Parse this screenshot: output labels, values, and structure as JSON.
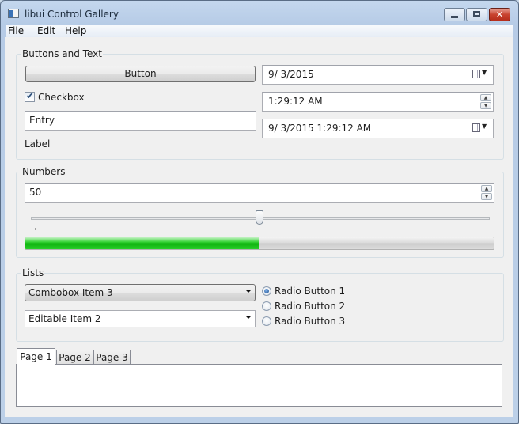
{
  "window": {
    "title": "libui Control Gallery"
  },
  "menubar": {
    "items": [
      "File",
      "Edit",
      "Help"
    ]
  },
  "buttons_and_text": {
    "group_label": "Buttons and Text",
    "button_label": "Button",
    "checkbox_label": "Checkbox",
    "checkbox_checked": true,
    "entry_value": "Entry",
    "label_text": "Label",
    "date_value": "9/  3/2015",
    "time_value": "1:29:12 AM",
    "datetime_value": "9/  3/2015   1:29:12 AM"
  },
  "numbers": {
    "group_label": "Numbers",
    "spinbox_value": "50",
    "slider_value": 50,
    "progress_value": 50,
    "progress_color": "#1ec41e"
  },
  "lists": {
    "group_label": "Lists",
    "combobox_selected": "Combobox Item 3",
    "editable_combobox_value": "Editable Item 2",
    "radio_buttons": [
      {
        "label": "Radio Button 1",
        "selected": true
      },
      {
        "label": "Radio Button 2",
        "selected": false
      },
      {
        "label": "Radio Button 3",
        "selected": false
      }
    ]
  },
  "tabs": [
    {
      "label": "Page 1",
      "active": true
    },
    {
      "label": "Page 2",
      "active": false
    },
    {
      "label": "Page 3",
      "active": false
    }
  ]
}
